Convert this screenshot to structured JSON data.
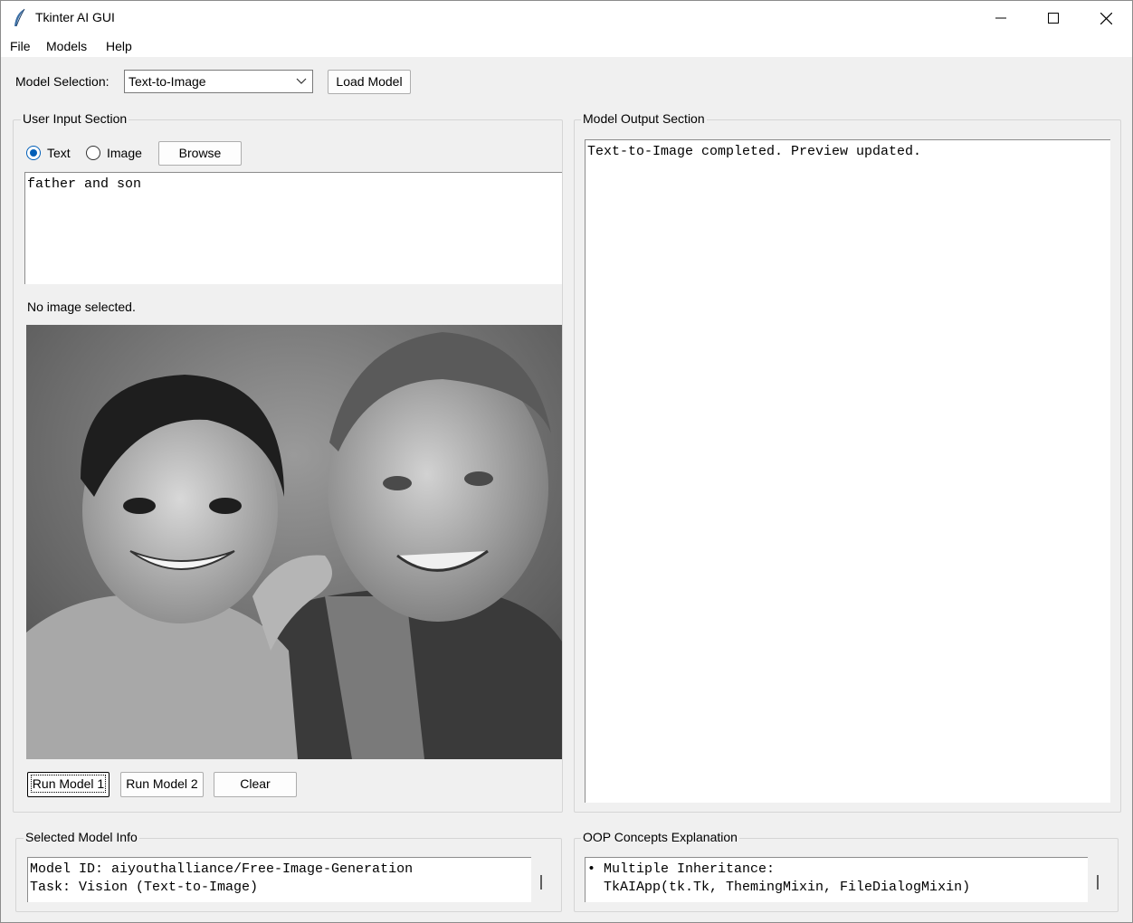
{
  "window": {
    "title": "Tkinter AI GUI",
    "controls": [
      "minimize",
      "maximize",
      "close"
    ]
  },
  "menubar": {
    "items": [
      "File",
      "Models",
      "Help"
    ]
  },
  "toolbar": {
    "model_selection_label": "Model Selection:",
    "model_selection_value": "Text-to-Image",
    "load_model_label": "Load Model"
  },
  "input_section": {
    "title": "User Input Section",
    "radio_text_label": "Text",
    "radio_image_label": "Image",
    "radio_selected": "Text",
    "browse_label": "Browse",
    "prompt_text": "father and son",
    "image_status": "No image selected.",
    "image_description": "grayscale photo of a smiling boy and an older man",
    "run_model_1_label": "Run Model 1",
    "run_model_2_label": "Run Model 2",
    "clear_label": "Clear"
  },
  "output_section": {
    "title": "Model Output Section",
    "output_text": "Text-to-Image completed. Preview updated."
  },
  "model_info": {
    "title": "Selected Model Info",
    "line1": "Model ID: aiyouthalliance/Free-Image-Generation",
    "line2": "Task: Vision (Text-to-Image)"
  },
  "oop_section": {
    "title": "OOP Concepts Explanation",
    "line1": "• Multiple Inheritance:",
    "line2": "  TkAIApp(tk.Tk, ThemingMixin, FileDialogMixin)"
  },
  "colors": {
    "accent": "#005fb8",
    "window_bg": "#f0f0f0",
    "field_bg": "#ffffff"
  }
}
